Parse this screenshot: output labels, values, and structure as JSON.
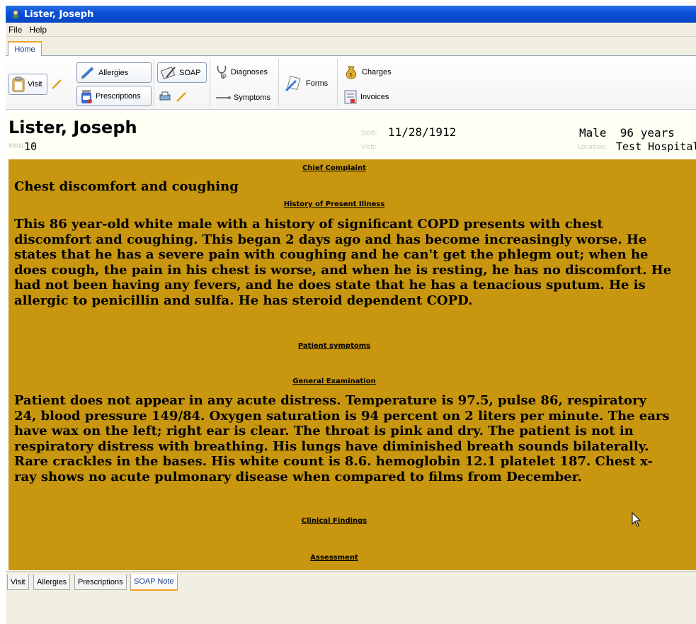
{
  "window": {
    "title": "Lister, Joseph"
  },
  "menu": {
    "file": "File",
    "help": "Help"
  },
  "ribbon": {
    "tab_home": "Home",
    "visit": "Visit",
    "allergies": "Allergies",
    "prescriptions": "Prescriptions",
    "soap": "SOAP",
    "diagnoses": "Diagnoses",
    "symptoms": "Symptoms",
    "forms": "Forms",
    "charges": "Charges",
    "invoices": "Invoices"
  },
  "patient": {
    "name": "Lister, Joseph",
    "mrn_label": "MRN:",
    "mrn": "10",
    "dob_label": "DOB:",
    "dob": "11/28/1912",
    "visit_label": "Visit:",
    "gender_age": "Male  96 years",
    "location_label": "Location:",
    "location": "Test Hospital"
  },
  "soap": {
    "chief_complaint_heading": "Chief Complaint",
    "chief_complaint": "Chest discomfort and coughing",
    "hpi_heading": "History of Present Illness",
    "hpi": "This 86 year-old white male with a history of significant COPD presents with chest discomfort and coughing. This began 2 days ago and has become increasingly worse. He states that he has a severe pain with coughing and he can't get the phlegm out; when he does cough, the pain in his chest is worse, and when he is resting, he has no discomfort. He had not been having any fevers, and he does state that he has a tenacious sputum. He is allergic to penicillin and sulfa. He has steroid dependent COPD.",
    "symptoms_heading": "Patient symptoms",
    "exam_heading": "General Examination",
    "exam": "Patient does not appear in any acute distress. Temperature is 97.5, pulse 86, respiratory 24, blood pressure 149/84. Oxygen saturation is 94 percent on 2 liters per minute. The ears have wax on the left; right ear is clear. The throat is pink and dry. The patient is not in respiratory distress with breathing. His lungs have diminished breath sounds bilaterally. Rare crackles in the bases. His white count is 8.6. hemoglobin 12.1 platelet 187. Chest x-ray shows no acute pulmonary disease when compared to films from December.",
    "findings_heading": "Clinical Findings",
    "assessment_heading": "Assessment"
  },
  "bottom_tabs": [
    "Visit",
    "Allergies",
    "Prescriptions",
    "SOAP Note"
  ],
  "colors": {
    "titlebar": "#0a50d8",
    "content_bg": "#c8960f",
    "active_tab_accent": "#f0a020"
  }
}
